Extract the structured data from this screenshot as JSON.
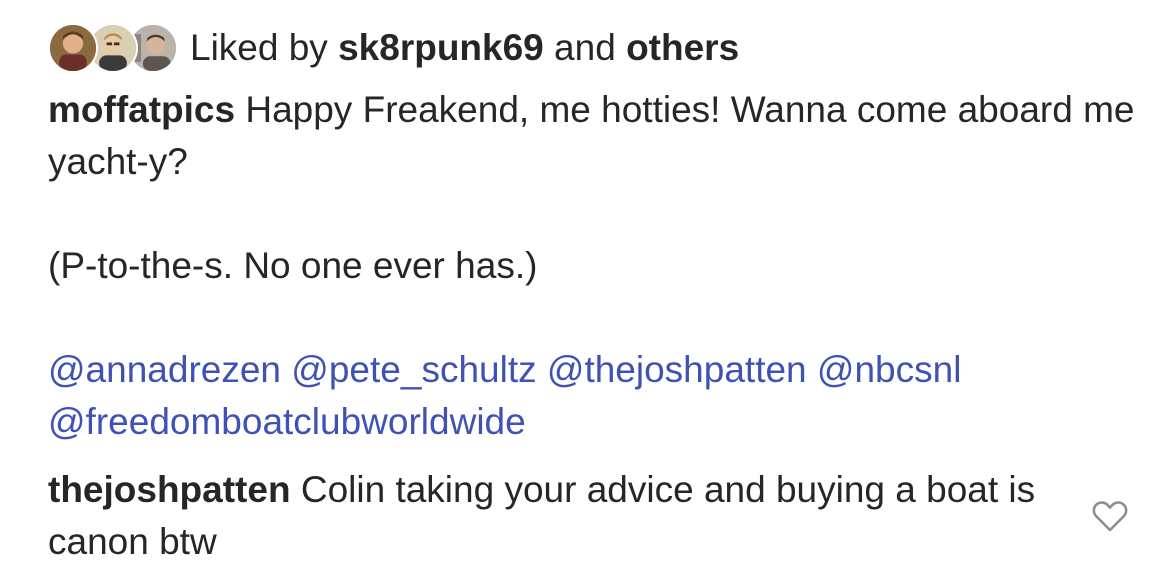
{
  "likes": {
    "prefix": "Liked by ",
    "user": "sk8rpunk69",
    "connector": " and ",
    "others": "others"
  },
  "post": {
    "username": "moffatpics",
    "caption_line1": " Happy Freakend, me hotties! Wanna come aboard me yacht-y?",
    "caption_line2": "(P-to-the-s. No one ever has.)",
    "mentions": [
      "@annadrezen",
      "@pete_schultz",
      "@thejoshpatten",
      "@nbcsnl",
      "@freedomboatclubworldwide"
    ]
  },
  "comment": {
    "username": "thejoshpatten",
    "text": " Colin taking your advice and buying a boat is canon btw"
  },
  "icons": {
    "like": "heart-outline-icon",
    "avatars": [
      "avatar-photo-1",
      "avatar-photo-2",
      "avatar-photo-3"
    ]
  },
  "colors": {
    "text": "#262626",
    "mention": "#3f52b4",
    "icon": "#8e8e8e"
  }
}
